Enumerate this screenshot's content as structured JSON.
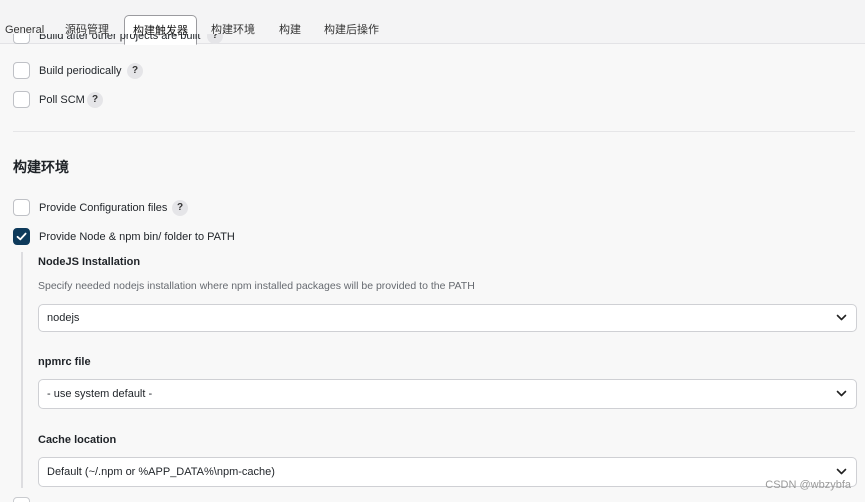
{
  "tabs": [
    {
      "label": "General",
      "active": false
    },
    {
      "label": "源码管理",
      "active": false
    },
    {
      "label": "构建触发器",
      "active": true
    },
    {
      "label": "构建环境",
      "active": false
    },
    {
      "label": "构建",
      "active": false
    },
    {
      "label": "构建后操作",
      "active": false
    }
  ],
  "triggers": {
    "cut_item": {
      "label": "Build after other projects are built",
      "checked": false
    },
    "build_periodically": {
      "label": "Build periodically",
      "checked": false,
      "help": "?"
    },
    "poll_scm": {
      "label": "Poll SCM",
      "checked": false,
      "help": "?"
    }
  },
  "build_env": {
    "title": "构建环境",
    "provide_config": {
      "label": "Provide Configuration files",
      "checked": false,
      "help": "?"
    },
    "provide_node": {
      "label": "Provide Node & npm bin/ folder to PATH",
      "checked": true
    },
    "nodejs_installation": {
      "label": "NodeJS Installation",
      "description": "Specify needed nodejs installation where npm installed packages will be provided to the PATH",
      "value": "nodejs"
    },
    "npmrc_file": {
      "label": "npmrc file",
      "value": "- use system default -"
    },
    "cache_location": {
      "label": "Cache location",
      "value": "Default (~/.npm or %APP_DATA%\\npm-cache)"
    }
  },
  "watermark": "CSDN @wbzybfa",
  "colors": {
    "checked": "#0e3a5b",
    "background": "#f8f8f8"
  }
}
